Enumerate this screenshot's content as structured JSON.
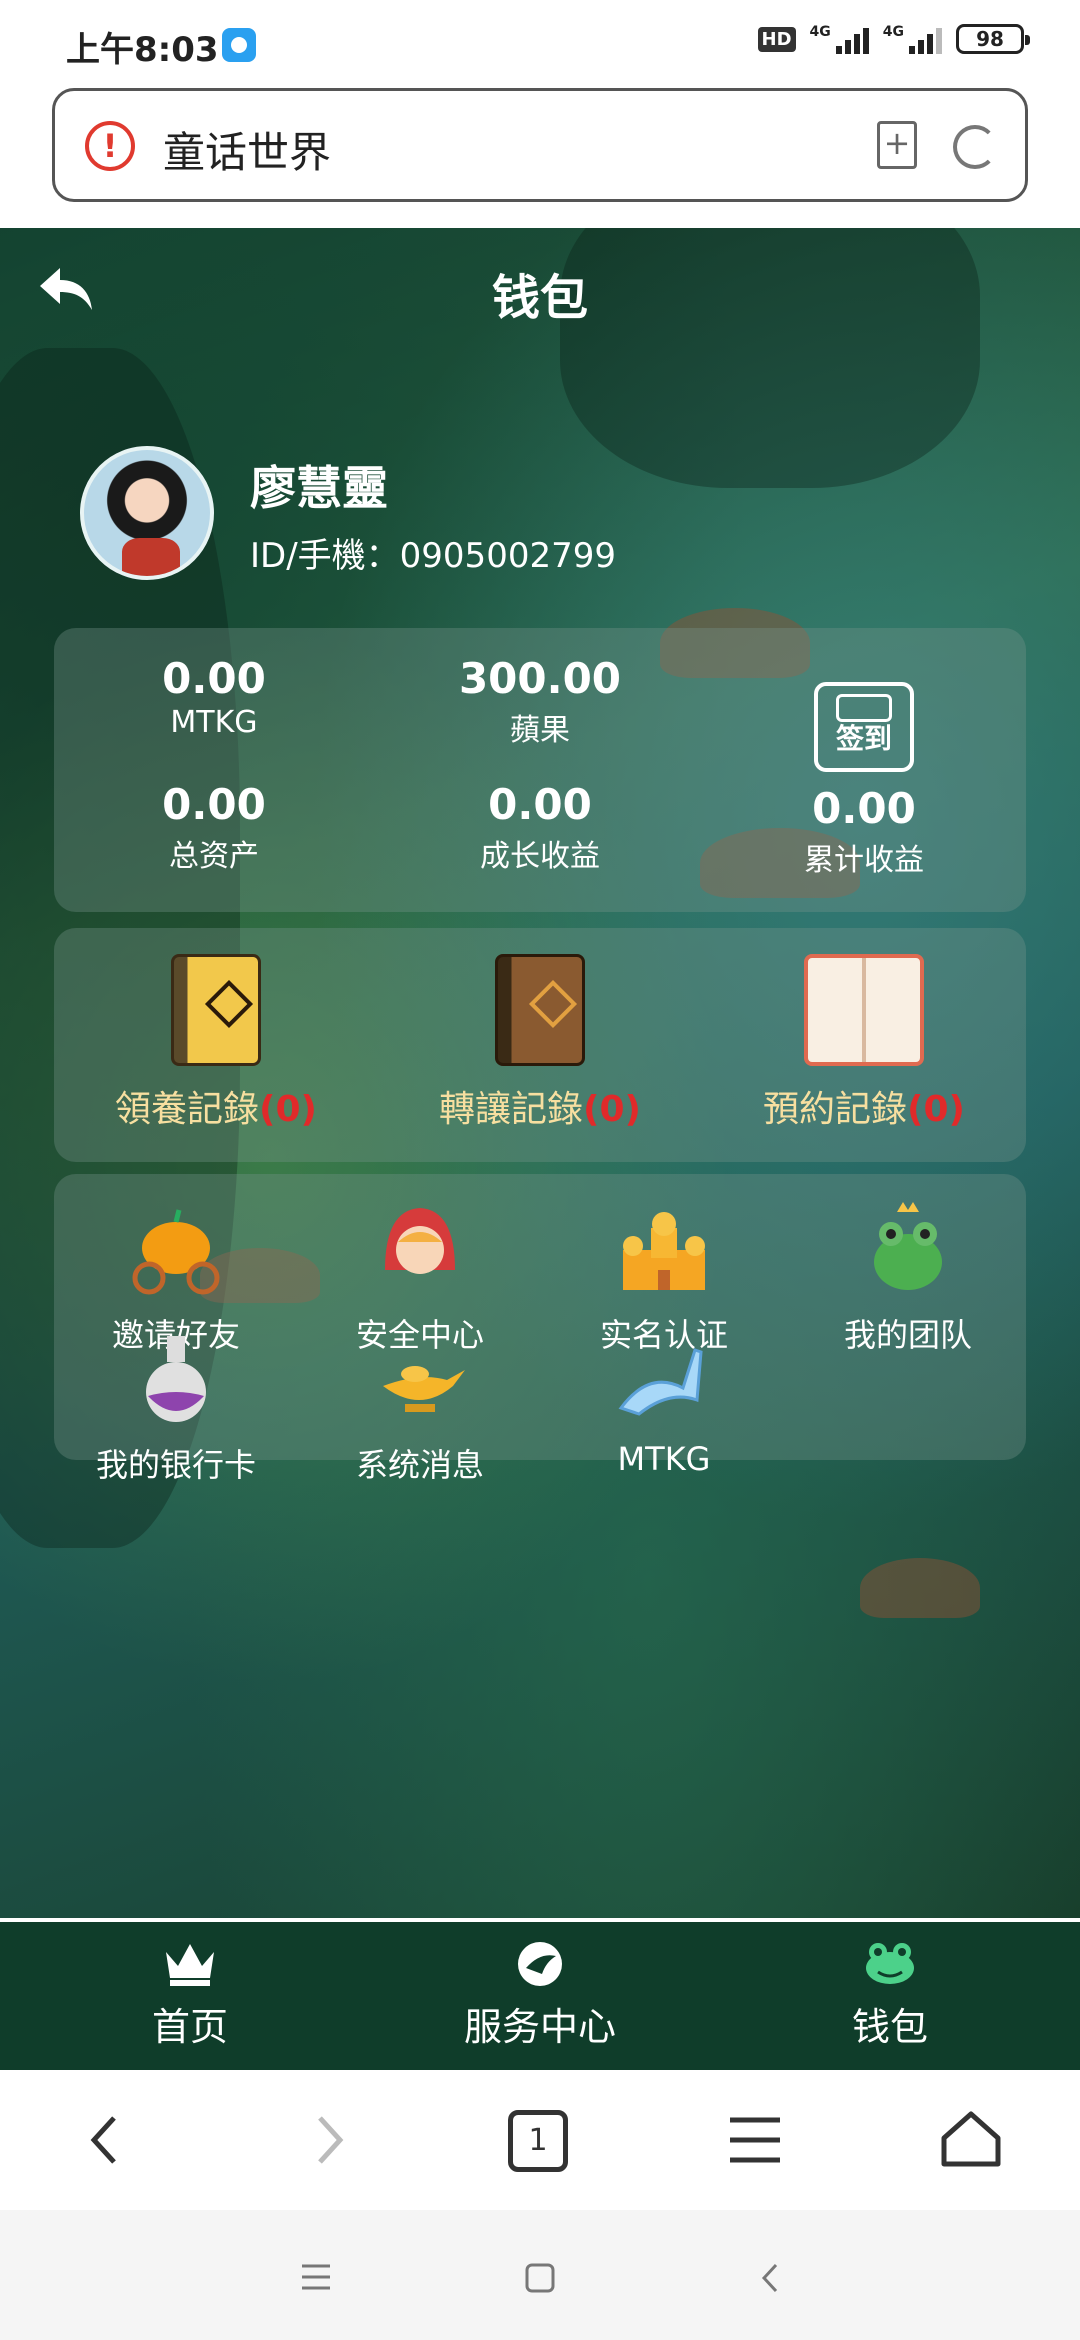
{
  "status_bar": {
    "time": "上午8:03",
    "hd": "HD",
    "net1": "4G",
    "net2": "4G",
    "battery": "98"
  },
  "address_bar": {
    "title": "童话世界"
  },
  "header": {
    "title": "钱包"
  },
  "profile": {
    "name": "廖慧靈",
    "id_label": "ID/手機：0905002799"
  },
  "stats": [
    {
      "value": "0.00",
      "label": "MTKG"
    },
    {
      "value": "300.00",
      "label": "蘋果"
    },
    {
      "value": "0.00",
      "label": "总资产"
    },
    {
      "value": "0.00",
      "label": "成长收益"
    },
    {
      "value": "0.00",
      "label": "累计收益"
    }
  ],
  "checkin": {
    "label": "签到"
  },
  "records": [
    {
      "label": "領養記錄",
      "count": "(0)"
    },
    {
      "label": "轉讓記錄",
      "count": "(0)"
    },
    {
      "label": "預約記錄",
      "count": "(0)"
    }
  ],
  "menu": [
    {
      "label": "邀请好友",
      "icon": "pumpkin-carriage-icon"
    },
    {
      "label": "安全中心",
      "icon": "little-red-riding-hood-icon"
    },
    {
      "label": "实名认证",
      "icon": "castle-icon"
    },
    {
      "label": "我的团队",
      "icon": "frog-prince-icon"
    },
    {
      "label": "我的银行卡",
      "icon": "potion-flask-icon"
    },
    {
      "label": "系统消息",
      "icon": "magic-lamp-icon"
    },
    {
      "label": "MTKG",
      "icon": "glass-slipper-icon"
    }
  ],
  "bottom_nav": [
    {
      "label": "首页",
      "icon": "crown-icon"
    },
    {
      "label": "服务中心",
      "icon": "bird-icon"
    },
    {
      "label": "钱包",
      "icon": "frog-icon"
    }
  ],
  "browser_toolbar": {
    "tab_count": "1"
  },
  "colors": {
    "nav_bg": "#0f3d2a",
    "record_label": "#f7dfa0",
    "record_count": "#e02a2a",
    "warning": "#e03a2f"
  }
}
